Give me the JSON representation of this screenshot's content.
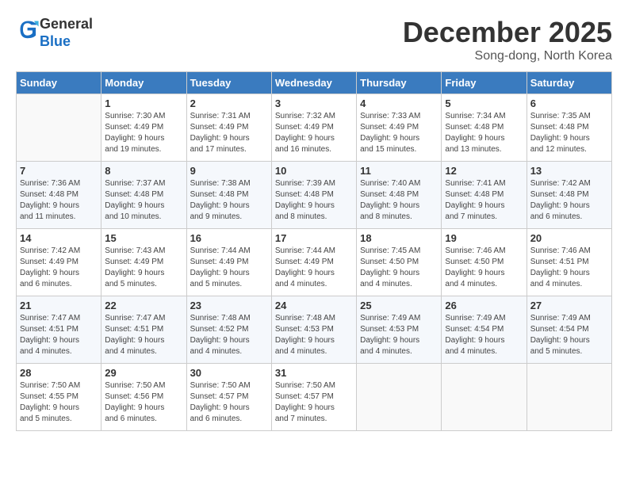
{
  "header": {
    "logo_line1": "General",
    "logo_line2": "Blue",
    "month": "December 2025",
    "location": "Song-dong, North Korea"
  },
  "days_of_week": [
    "Sunday",
    "Monday",
    "Tuesday",
    "Wednesday",
    "Thursday",
    "Friday",
    "Saturday"
  ],
  "weeks": [
    [
      {
        "day": "",
        "info": ""
      },
      {
        "day": "1",
        "info": "Sunrise: 7:30 AM\nSunset: 4:49 PM\nDaylight: 9 hours\nand 19 minutes."
      },
      {
        "day": "2",
        "info": "Sunrise: 7:31 AM\nSunset: 4:49 PM\nDaylight: 9 hours\nand 17 minutes."
      },
      {
        "day": "3",
        "info": "Sunrise: 7:32 AM\nSunset: 4:49 PM\nDaylight: 9 hours\nand 16 minutes."
      },
      {
        "day": "4",
        "info": "Sunrise: 7:33 AM\nSunset: 4:49 PM\nDaylight: 9 hours\nand 15 minutes."
      },
      {
        "day": "5",
        "info": "Sunrise: 7:34 AM\nSunset: 4:48 PM\nDaylight: 9 hours\nand 13 minutes."
      },
      {
        "day": "6",
        "info": "Sunrise: 7:35 AM\nSunset: 4:48 PM\nDaylight: 9 hours\nand 12 minutes."
      }
    ],
    [
      {
        "day": "7",
        "info": "Sunrise: 7:36 AM\nSunset: 4:48 PM\nDaylight: 9 hours\nand 11 minutes."
      },
      {
        "day": "8",
        "info": "Sunrise: 7:37 AM\nSunset: 4:48 PM\nDaylight: 9 hours\nand 10 minutes."
      },
      {
        "day": "9",
        "info": "Sunrise: 7:38 AM\nSunset: 4:48 PM\nDaylight: 9 hours\nand 9 minutes."
      },
      {
        "day": "10",
        "info": "Sunrise: 7:39 AM\nSunset: 4:48 PM\nDaylight: 9 hours\nand 8 minutes."
      },
      {
        "day": "11",
        "info": "Sunrise: 7:40 AM\nSunset: 4:48 PM\nDaylight: 9 hours\nand 8 minutes."
      },
      {
        "day": "12",
        "info": "Sunrise: 7:41 AM\nSunset: 4:48 PM\nDaylight: 9 hours\nand 7 minutes."
      },
      {
        "day": "13",
        "info": "Sunrise: 7:42 AM\nSunset: 4:48 PM\nDaylight: 9 hours\nand 6 minutes."
      }
    ],
    [
      {
        "day": "14",
        "info": "Sunrise: 7:42 AM\nSunset: 4:49 PM\nDaylight: 9 hours\nand 6 minutes."
      },
      {
        "day": "15",
        "info": "Sunrise: 7:43 AM\nSunset: 4:49 PM\nDaylight: 9 hours\nand 5 minutes."
      },
      {
        "day": "16",
        "info": "Sunrise: 7:44 AM\nSunset: 4:49 PM\nDaylight: 9 hours\nand 5 minutes."
      },
      {
        "day": "17",
        "info": "Sunrise: 7:44 AM\nSunset: 4:49 PM\nDaylight: 9 hours\nand 4 minutes."
      },
      {
        "day": "18",
        "info": "Sunrise: 7:45 AM\nSunset: 4:50 PM\nDaylight: 9 hours\nand 4 minutes."
      },
      {
        "day": "19",
        "info": "Sunrise: 7:46 AM\nSunset: 4:50 PM\nDaylight: 9 hours\nand 4 minutes."
      },
      {
        "day": "20",
        "info": "Sunrise: 7:46 AM\nSunset: 4:51 PM\nDaylight: 9 hours\nand 4 minutes."
      }
    ],
    [
      {
        "day": "21",
        "info": "Sunrise: 7:47 AM\nSunset: 4:51 PM\nDaylight: 9 hours\nand 4 minutes."
      },
      {
        "day": "22",
        "info": "Sunrise: 7:47 AM\nSunset: 4:51 PM\nDaylight: 9 hours\nand 4 minutes."
      },
      {
        "day": "23",
        "info": "Sunrise: 7:48 AM\nSunset: 4:52 PM\nDaylight: 9 hours\nand 4 minutes."
      },
      {
        "day": "24",
        "info": "Sunrise: 7:48 AM\nSunset: 4:53 PM\nDaylight: 9 hours\nand 4 minutes."
      },
      {
        "day": "25",
        "info": "Sunrise: 7:49 AM\nSunset: 4:53 PM\nDaylight: 9 hours\nand 4 minutes."
      },
      {
        "day": "26",
        "info": "Sunrise: 7:49 AM\nSunset: 4:54 PM\nDaylight: 9 hours\nand 4 minutes."
      },
      {
        "day": "27",
        "info": "Sunrise: 7:49 AM\nSunset: 4:54 PM\nDaylight: 9 hours\nand 5 minutes."
      }
    ],
    [
      {
        "day": "28",
        "info": "Sunrise: 7:50 AM\nSunset: 4:55 PM\nDaylight: 9 hours\nand 5 minutes."
      },
      {
        "day": "29",
        "info": "Sunrise: 7:50 AM\nSunset: 4:56 PM\nDaylight: 9 hours\nand 6 minutes."
      },
      {
        "day": "30",
        "info": "Sunrise: 7:50 AM\nSunset: 4:57 PM\nDaylight: 9 hours\nand 6 minutes."
      },
      {
        "day": "31",
        "info": "Sunrise: 7:50 AM\nSunset: 4:57 PM\nDaylight: 9 hours\nand 7 minutes."
      },
      {
        "day": "",
        "info": ""
      },
      {
        "day": "",
        "info": ""
      },
      {
        "day": "",
        "info": ""
      }
    ]
  ]
}
